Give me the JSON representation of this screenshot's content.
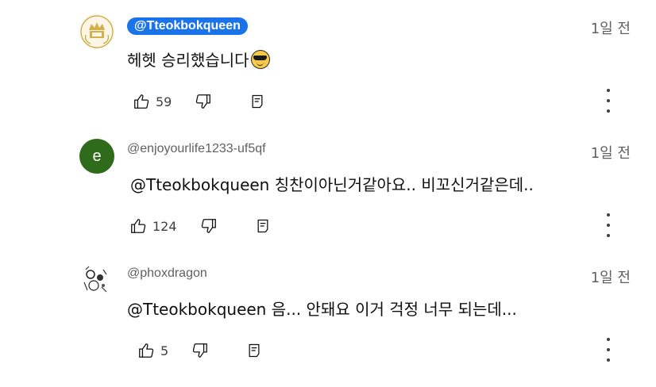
{
  "comments": [
    {
      "author": "@Tteokbokqueen",
      "time": "1일 전",
      "text": "헤헷 승리했습니다",
      "likes": "59",
      "avatar": "crown-logo"
    },
    {
      "author": "@enjoyourlife1233-uf5qf",
      "time": "1일 전",
      "text": "@Tteokbokqueen  칭찬이아닌거같아요.. 비꼬신거같은데..",
      "likes": "124",
      "avatar_letter": "e",
      "avatar_color": "#2e6b1a"
    },
    {
      "author": "@phoxdragon",
      "time": "1일 전",
      "text": "@Tteokbokqueen 음... 안돼요 이거 걱정 너무 되는데...",
      "likes": "5",
      "avatar": "floral-sketch"
    }
  ],
  "icons": {
    "like": "thumbs-up-icon",
    "dislike": "thumbs-down-icon",
    "reply": "reply-icon",
    "more": "more-vertical-icon",
    "emoji": "sunglasses-emoji-icon"
  },
  "colors": {
    "owner_badge": "#1a73e8",
    "secondary_text": "#606060"
  }
}
